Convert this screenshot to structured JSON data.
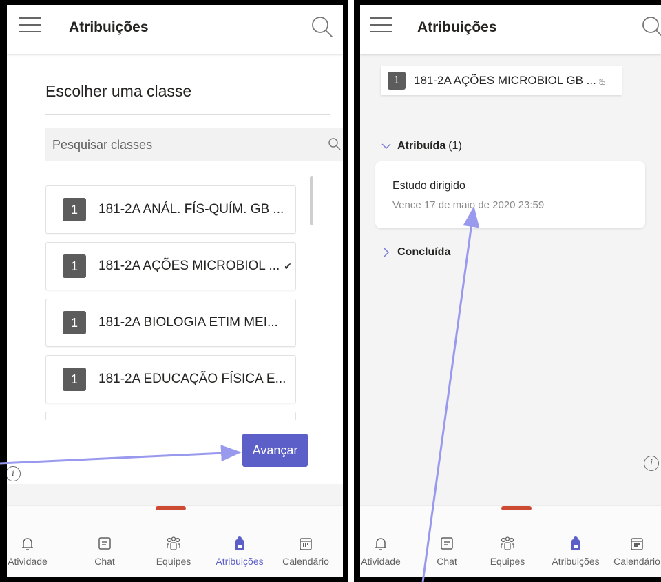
{
  "left_screen": {
    "title": "Atribuições",
    "heading": "Escolher uma classe",
    "search_placeholder": "Pesquisar classes",
    "classes": [
      {
        "badge": "1",
        "name": "181-2A ANÁL. FÍS-QUÍM. GB ...",
        "checked": false
      },
      {
        "badge": "1",
        "name": "181-2A AÇÕES MICROBIOL ...",
        "checked": true
      },
      {
        "badge": "1",
        "name": "181-2A BIOLOGIA ETIM MEI...",
        "checked": false
      },
      {
        "badge": "1",
        "name": "181-2A EDUCAÇÃO FÍSICA E...",
        "checked": false
      }
    ],
    "advance_label": "Avançar",
    "info_glyph": "i",
    "check_glyph": "✔"
  },
  "right_screen": {
    "title": "Atribuições",
    "class_chip": {
      "badge": "1",
      "name": "181-2A AÇÕES MICROBIOL GB ...",
      "team_glyph": "ஐ"
    },
    "assigned_section": {
      "label": "Atribuída",
      "count": "(1)"
    },
    "assignment": {
      "title": "Estudo dirigido",
      "due": "Vence 17 de maio de 2020 23:59"
    },
    "completed_section": {
      "label": "Concluída"
    },
    "info_glyph": "i"
  },
  "tabs": [
    {
      "label": "Atividade",
      "icon": "bell-icon"
    },
    {
      "label": "Chat",
      "icon": "chat-icon"
    },
    {
      "label": "Equipes",
      "icon": "teams-icon"
    },
    {
      "label": "Atribuições",
      "icon": "backpack-icon",
      "active": true
    },
    {
      "label": "Calendário",
      "icon": "calendar-icon"
    }
  ],
  "colors": {
    "accent": "#5b5fc7",
    "handle": "#cc4a31",
    "annotation_arrow": "#9999ee",
    "badge": "#5c5c5c"
  }
}
